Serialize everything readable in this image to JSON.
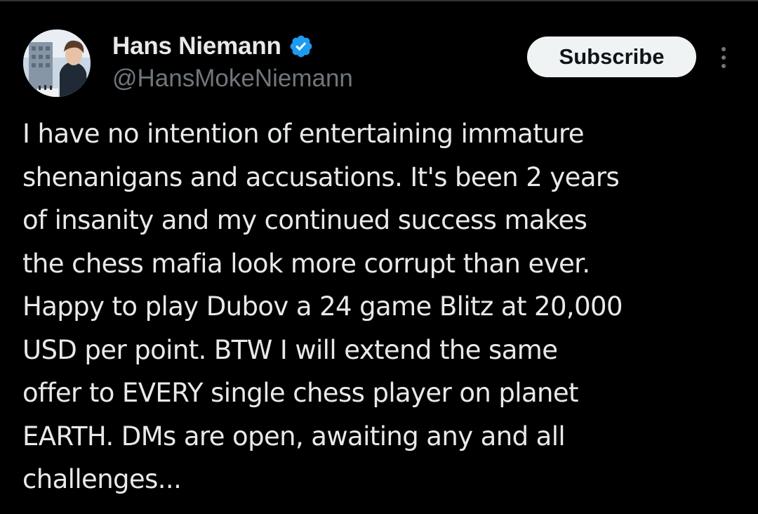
{
  "theme": {
    "background": "#000000",
    "text_primary": "#e7e9ea",
    "text_secondary": "#71767b",
    "verified_badge": "#1d9bf0",
    "button_bg": "#eff3f4",
    "button_text": "#0f1419"
  },
  "author": {
    "display_name": "Hans Niemann",
    "handle": "@HansMokeNiemann",
    "verified": true,
    "avatar_icon": "profile-photo",
    "verified_icon": "verified-badge-icon"
  },
  "actions": {
    "subscribe_label": "Subscribe",
    "more_icon": "more-options-icon"
  },
  "tweet": {
    "lines": [
      "I have no intention of entertaining immature",
      "shenanigans and accusations. It's been 2 years",
      "of insanity and my continued success makes",
      "the chess mafia look more corrupt than ever.",
      "Happy to play Dubov a 24 game Blitz at 20,000",
      "USD per point. BTW I will extend the same",
      "offer to EVERY single chess player on planet",
      "EARTH. DMs are open, awaiting any and all",
      "challenges..."
    ]
  }
}
